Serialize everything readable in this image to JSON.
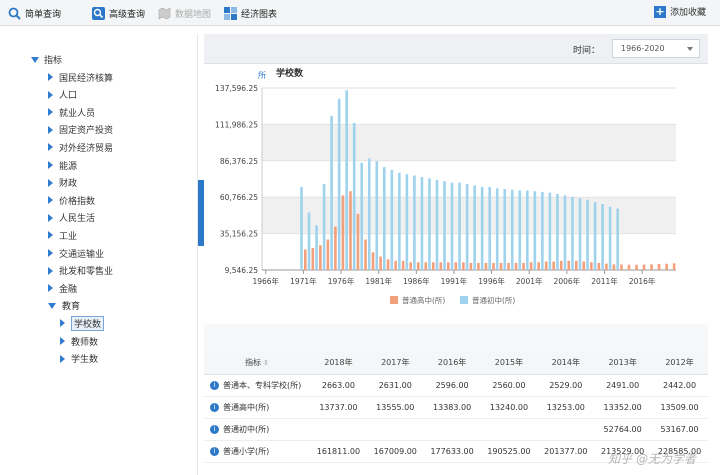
{
  "toolbar": {
    "simple_query": "简单查询",
    "advanced_query": "高级查询",
    "data_map": "数据地图",
    "econ_chart": "经济图表",
    "add_fav": "添加收藏"
  },
  "sidebar": {
    "root": "指标",
    "items": [
      "国民经济核算",
      "人口",
      "就业人员",
      "固定资产投资",
      "对外经济贸易",
      "能源",
      "财政",
      "价格指数",
      "人民生活",
      "工业",
      "交通运输业",
      "批发和零售业",
      "金融",
      "教育"
    ],
    "sub_items": [
      "学校数",
      "教师数",
      "学生数"
    ]
  },
  "time_filter": {
    "label": "时间：",
    "value": "1966-2020"
  },
  "chart_data": {
    "type": "bar",
    "title": "学校数",
    "ylabel": "所",
    "ylim": [
      9546.25,
      137596.25
    ],
    "yticks": [
      "137,596.25",
      "111,986.25",
      "86,376.25",
      "60,766.25",
      "35,156.25",
      "9,546.25"
    ],
    "xticks": [
      "1966年",
      "1971年",
      "1976年",
      "1981年",
      "1986年",
      "1991年",
      "1996年",
      "2001年",
      "2006年",
      "2011年",
      "2016年"
    ],
    "categories": [
      1966,
      1967,
      1968,
      1969,
      1970,
      1971,
      1972,
      1973,
      1974,
      1975,
      1976,
      1977,
      1978,
      1979,
      1980,
      1981,
      1982,
      1983,
      1984,
      1985,
      1986,
      1987,
      1988,
      1989,
      1990,
      1991,
      1992,
      1993,
      1994,
      1995,
      1996,
      1997,
      1998,
      1999,
      2000,
      2001,
      2002,
      2003,
      2004,
      2005,
      2006,
      2007,
      2008,
      2009,
      2010,
      2011,
      2012,
      2013,
      2014,
      2015,
      2016,
      2017,
      2018,
      2019,
      2020
    ],
    "series": [
      {
        "name": "普通高中(所)",
        "color": "#f2a07b",
        "values": [
          null,
          null,
          null,
          null,
          null,
          24000,
          25000,
          27000,
          31000,
          40000,
          62000,
          65000,
          49000,
          31000,
          22000,
          19000,
          17000,
          16000,
          16000,
          15000,
          15000,
          15000,
          15000,
          15000,
          15000,
          15000,
          15000,
          14500,
          14500,
          14500,
          14500,
          14500,
          14500,
          14500,
          14500,
          15000,
          15000,
          15500,
          15500,
          16000,
          16000,
          16000,
          15500,
          15000,
          14500,
          14000,
          13500,
          13352,
          13253,
          13240,
          13383,
          13555,
          13737,
          13964,
          14235
        ]
      },
      {
        "name": "普通初中(所)",
        "color": "#9fd2ec",
        "values": [
          null,
          null,
          null,
          null,
          null,
          68000,
          50000,
          41000,
          70000,
          118000,
          130000,
          136000,
          113000,
          85000,
          88000,
          86000,
          82000,
          80000,
          78000,
          77000,
          76000,
          75000,
          74000,
          73000,
          72000,
          71000,
          71000,
          70000,
          69000,
          68000,
          68000,
          67000,
          66500,
          66000,
          65500,
          65500,
          65000,
          64500,
          64000,
          63000,
          62000,
          61000,
          60000,
          59000,
          57500,
          56000,
          54000,
          52764,
          null,
          null,
          null,
          null,
          null,
          null,
          null
        ]
      }
    ],
    "legend_position": "bottom"
  },
  "table": {
    "headers": [
      "指标",
      "2018年",
      "2017年",
      "2016年",
      "2015年",
      "2014年",
      "2013年",
      "2012年"
    ],
    "rows": [
      {
        "name": "普通本、专科学校(所)",
        "values": [
          "2663.00",
          "2631.00",
          "2596.00",
          "2560.00",
          "2529.00",
          "2491.00",
          "2442.00"
        ]
      },
      {
        "name": "普通高中(所)",
        "values": [
          "13737.00",
          "13555.00",
          "13383.00",
          "13240.00",
          "13253.00",
          "13352.00",
          "13509.00"
        ]
      },
      {
        "name": "普通初中(所)",
        "values": [
          "",
          "",
          "",
          "",
          "",
          "52764.00",
          "53167.00"
        ]
      },
      {
        "name": "普通小学(所)",
        "values": [
          "161811.00",
          "167009.00",
          "177633.00",
          "190525.00",
          "201377.00",
          "213529.00",
          "228585.00"
        ]
      }
    ]
  },
  "watermark": "知乎 @无为学者"
}
